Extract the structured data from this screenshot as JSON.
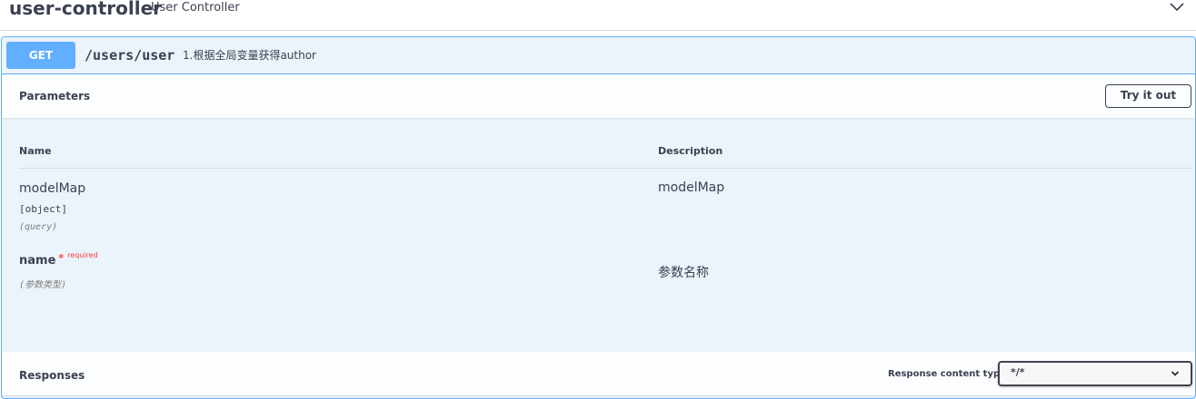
{
  "tag": {
    "name": "user-controller",
    "description": "User Controller"
  },
  "operation": {
    "method": "GET",
    "path": "/users/user",
    "summary": "1.根据全局变量获得author"
  },
  "parameters_section": {
    "title": "Parameters",
    "try_button": "Try it out",
    "column_name": "Name",
    "column_description": "Description",
    "params": [
      {
        "name": "modelMap",
        "type": "[object]",
        "in": "(query)",
        "description": "modelMap"
      },
      {
        "name": "name",
        "required_mark": "*",
        "required_label": "required",
        "in": "(参数类型)",
        "description": "参数名称"
      }
    ]
  },
  "responses_section": {
    "title": "Responses",
    "content_type_label": "Response content type",
    "content_type_value": "*/*"
  },
  "colors": {
    "get_accent": "#61affe",
    "block_background": "#ebf3fb",
    "text": "#3b4151",
    "required": "#ff3b3b"
  },
  "icons": {
    "tag_toggle": "chevron-down-icon",
    "select_toggle": "chevron-down-icon"
  }
}
